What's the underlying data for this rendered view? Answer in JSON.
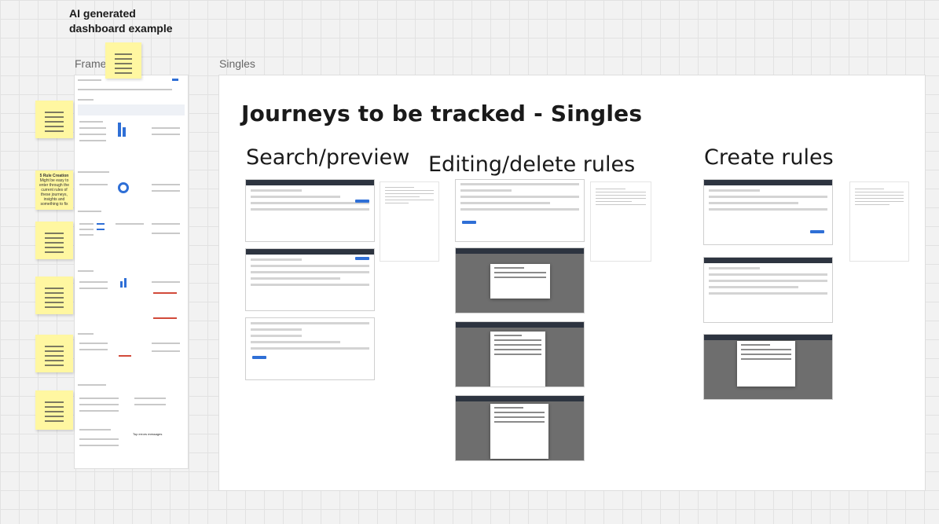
{
  "board": {
    "title_line1": "AI generated",
    "title_line2": "dashboard example"
  },
  "frames": {
    "frame4_label": "Frame 4",
    "singles_label": "Singles"
  },
  "singles": {
    "heading": "Journeys to be tracked - Singles",
    "columns": {
      "search": "Search/preview",
      "edit": "Editing/delete rules",
      "create": "Create rules"
    }
  },
  "stickies": {
    "rule_creation_title": "5 Rule Creation",
    "rule_creation_body": "Might be easy to enter through the current rules of these journeys, insights and something to fix"
  },
  "frame4_bottom_note": "Top errors messages",
  "colors": {
    "sticky": "#fff7a1",
    "accent": "#2f6fd6",
    "canvas": "#f2f2f2"
  }
}
